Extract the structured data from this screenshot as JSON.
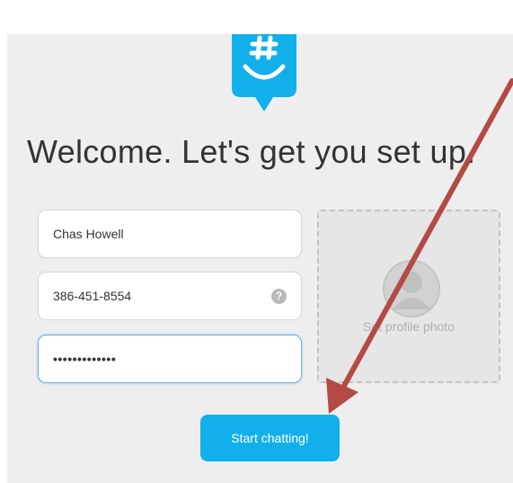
{
  "welcome": {
    "heading": "Welcome. Let's get you set up."
  },
  "form": {
    "name_value": "Chas Howell",
    "phone_value": "386-451-8554",
    "password_mask": "•••••••••••••",
    "help_glyph": "?"
  },
  "photo": {
    "label": "Set profile photo"
  },
  "start_button": {
    "label": "Start chatting!"
  },
  "colors": {
    "brand": "#12b0ea",
    "annotation_arrow": "#b34a45",
    "panel_background": "#eeeeee"
  },
  "icons": [
    "groupme-logo-icon",
    "help-icon",
    "avatar-placeholder-icon",
    "annotation-arrow-icon"
  ]
}
